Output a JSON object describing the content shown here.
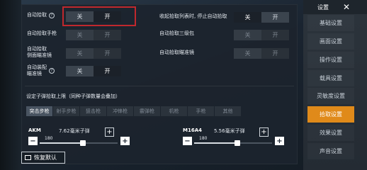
{
  "settings_rows": {
    "auto_pickup": {
      "label": "自动拾取",
      "help": "?",
      "off": "关",
      "on": "开"
    },
    "auto_pickup_pistol": {
      "label": "自动拾取手枪"
    },
    "auto_pickup_side_scope": {
      "label": "自动拾取\n侧面瞄准镜"
    },
    "auto_equip_scope": {
      "label": "自动装配\n瞄准镜",
      "help": "?",
      "off": "关",
      "on": "开"
    },
    "collapse_stop": {
      "label": "收起拾取列表时, 停止自动拾取",
      "off": "关",
      "on": "开"
    },
    "auto_pickup_lvl3": {
      "label": "自动拾取三级包"
    },
    "auto_pickup_scope": {
      "label": "自动拾取瞄准镜"
    }
  },
  "ammo_section": {
    "title": "设定子弹拾取上限（同种子弹数量会叠加）",
    "tabs": [
      "突击步枪",
      "射手步枪",
      "狙击枪",
      "冲锋枪",
      "霰弹枪",
      "机枪",
      "手枪",
      "其他"
    ],
    "active_tab": 0,
    "guns": [
      {
        "name": "AKM",
        "ammo": "7.62毫米子弹",
        "value": "180",
        "fraction": 0.55
      },
      {
        "name": "M16A4",
        "ammo": "5.56毫米子弹",
        "value": "180",
        "fraction": 0.55
      }
    ]
  },
  "reset_label": "恢复默认",
  "sidebar": {
    "title": "设置",
    "close": "✕",
    "items": [
      "基础设置",
      "画面设置",
      "操作设置",
      "载具设置",
      "灵敏度设置",
      "拾取设置",
      "效果设置",
      "声音设置"
    ],
    "active_index": 5
  },
  "toggle": {
    "off": "关",
    "on": "开"
  },
  "colors": {
    "accent": "#e08a1a",
    "highlight": "#c0282d"
  }
}
